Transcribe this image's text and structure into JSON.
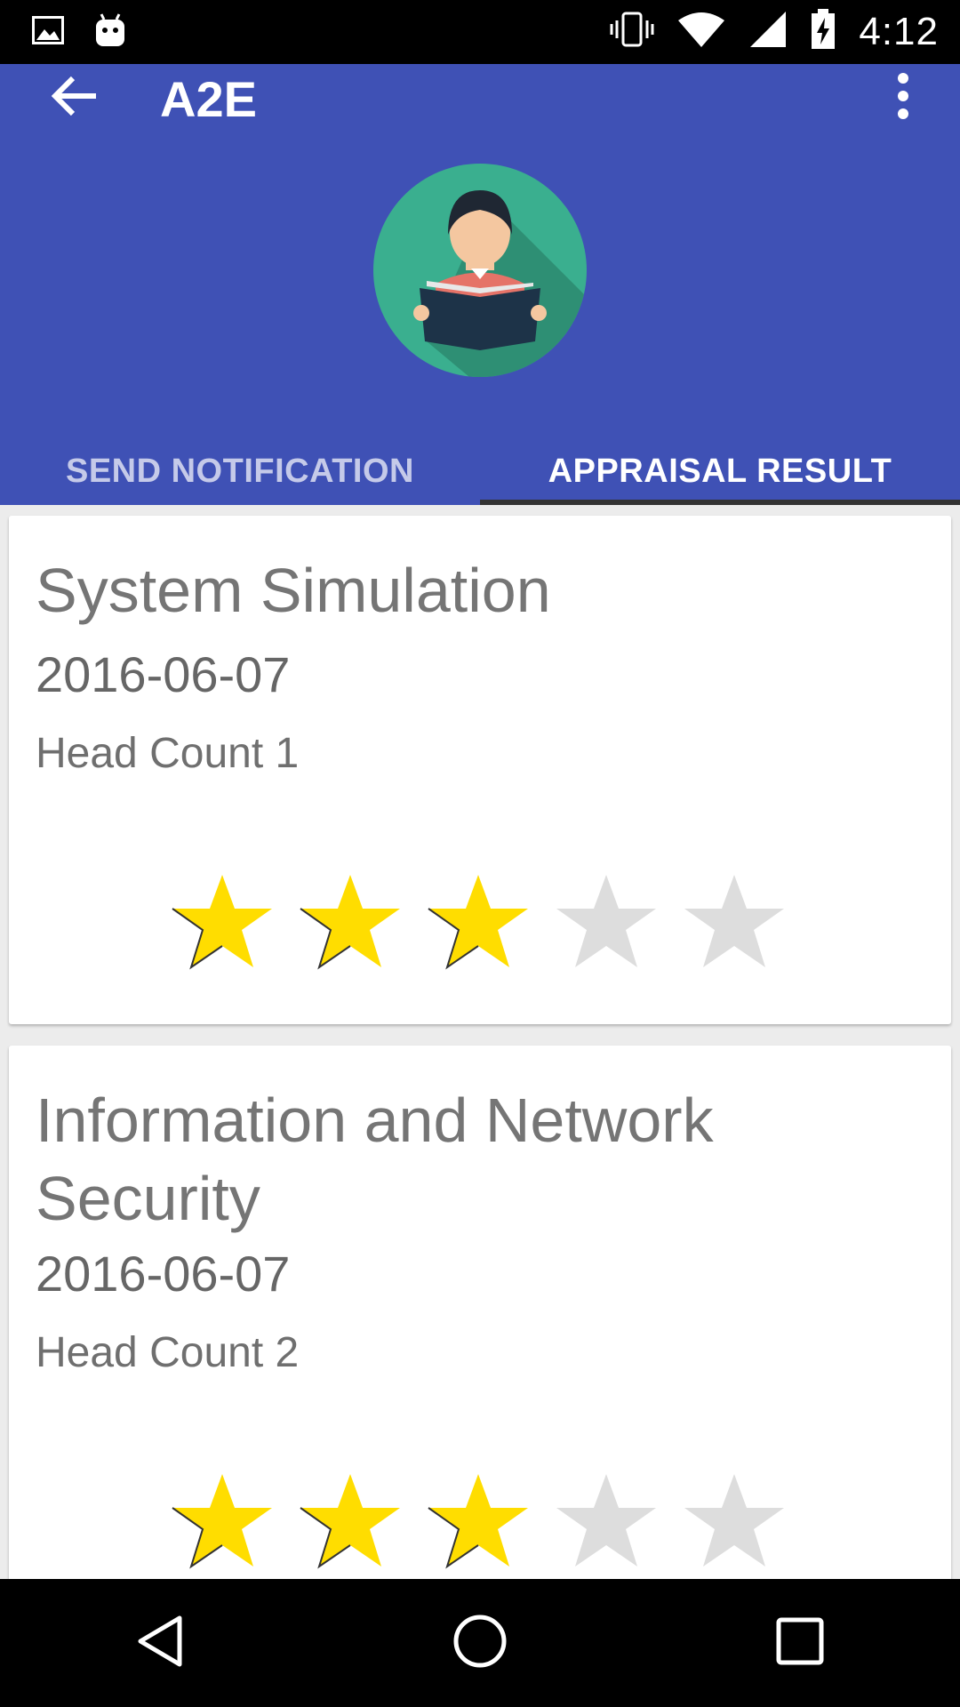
{
  "status_bar": {
    "time": "4:12",
    "icons": [
      "image-icon",
      "android-icon",
      "vibrate-icon",
      "wifi-icon",
      "signal-icon",
      "battery-charging-icon"
    ]
  },
  "app_bar": {
    "title": "A2E",
    "back_icon": "arrow-back-icon",
    "menu_icon": "more-vert-icon",
    "avatar_icon": "student-reading-avatar"
  },
  "tabs": [
    {
      "label": "SEND NOTIFICATION",
      "active": false
    },
    {
      "label": "APPRAISAL RESULT",
      "active": true
    }
  ],
  "cards": [
    {
      "title": "System Simulation",
      "date": "2016-06-07",
      "head_count": "Head Count 1",
      "rating": 3,
      "max_rating": 5
    },
    {
      "title": "Information and Network Security",
      "date": "2016-06-07",
      "head_count": "Head Count 2",
      "rating": 3,
      "max_rating": 5
    }
  ],
  "colors": {
    "primary": "#3f51b5",
    "star_filled": "#ffdd00",
    "star_empty": "#dddddd",
    "tab_inactive": "#c5cae9"
  },
  "nav_bar": {
    "icons": [
      "back-triangle-icon",
      "home-circle-icon",
      "recents-square-icon"
    ]
  }
}
